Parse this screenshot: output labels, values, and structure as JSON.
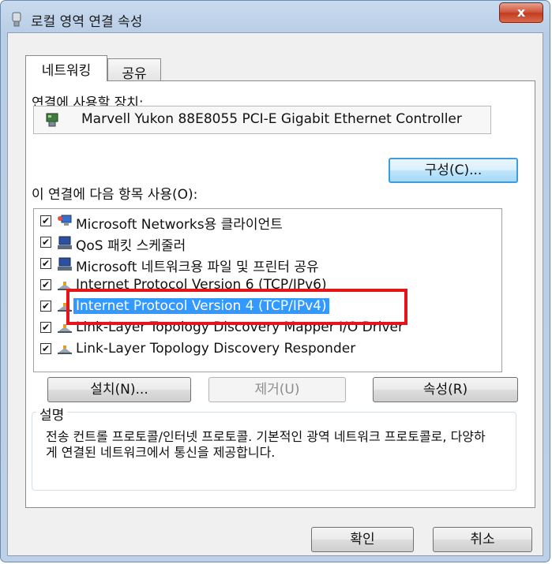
{
  "window": {
    "title": "로컬 영역 연결 속성",
    "close_label": "x"
  },
  "tabs": [
    {
      "label": "네트워킹",
      "active": true
    },
    {
      "label": "공유",
      "active": false
    }
  ],
  "connect_using": {
    "label": "연결에 사용할 장치:",
    "device_name": "Marvell Yukon 88E8055 PCI-E Gigabit Ethernet Controller",
    "configure_button": "구성(C)..."
  },
  "items_section": {
    "label": "이 연결에 다음 항목 사용(O):",
    "items": [
      {
        "label": "Microsoft Networks용 클라이언트",
        "checked": true,
        "icon": "network-client-icon",
        "selected": false
      },
      {
        "label": "QoS 패킷 스케줄러",
        "checked": true,
        "icon": "service-icon",
        "selected": false
      },
      {
        "label": "Microsoft 네트워크용 파일 및 프린터 공유",
        "checked": true,
        "icon": "service-icon",
        "selected": false
      },
      {
        "label": "Internet Protocol Version 6 (TCP/IPv6)",
        "checked": true,
        "icon": "protocol-icon",
        "selected": false
      },
      {
        "label": "Internet Protocol Version 4 (TCP/IPv4)",
        "checked": true,
        "icon": "protocol-icon",
        "selected": true
      },
      {
        "label": "Link-Layer Topology Discovery Mapper I/O Driver",
        "checked": true,
        "icon": "protocol-icon",
        "selected": false
      },
      {
        "label": "Link-Layer Topology Discovery Responder",
        "checked": true,
        "icon": "protocol-icon",
        "selected": false
      }
    ]
  },
  "item_buttons": {
    "install": "설치(N)...",
    "uninstall": "제거(U)",
    "properties": "속성(R)"
  },
  "description": {
    "legend": "설명",
    "text": "전송 컨트롤 프로토콜/인터넷 프로토콜. 기본적인 광역 네트워크 프로토콜로, 다양하게 연결된 네트워크에서 통신을 제공합니다."
  },
  "dialog_buttons": {
    "ok": "확인",
    "cancel": "취소"
  },
  "colors": {
    "selection": "#3399ff",
    "highlight_box": "#e8141b",
    "close_button": "#c23b20"
  }
}
